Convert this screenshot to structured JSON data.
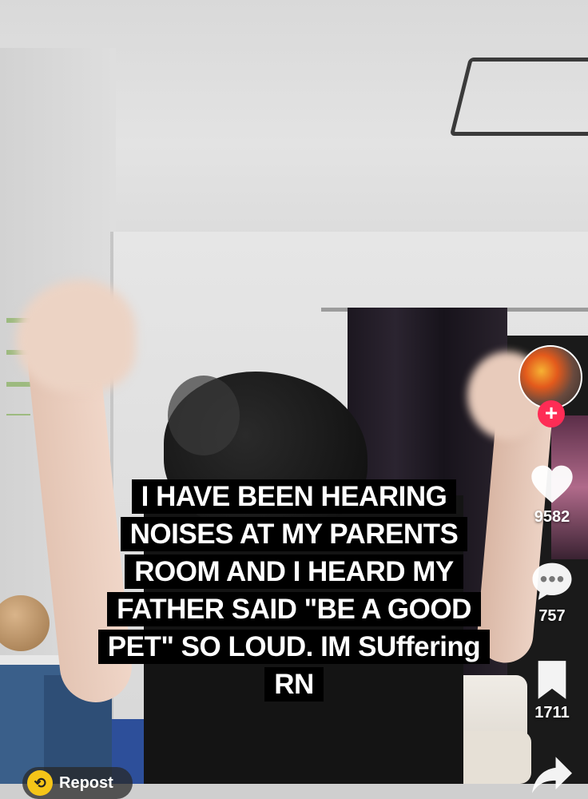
{
  "caption": "I HAVE BEEN HEARING NOISES AT MY PARENTS ROOM AND I HEARD MY FATHER SAID \"BE A GOOD PET\" SO LOUD. IM SUffering RN",
  "rail": {
    "follow_symbol": "+",
    "likes": "9582",
    "comments": "757",
    "saves": "1711"
  },
  "repost": {
    "label": "Repost",
    "icon": "repost-icon"
  },
  "colors": {
    "follow": "#fe2c55",
    "repost_badge": "#f5c518"
  }
}
